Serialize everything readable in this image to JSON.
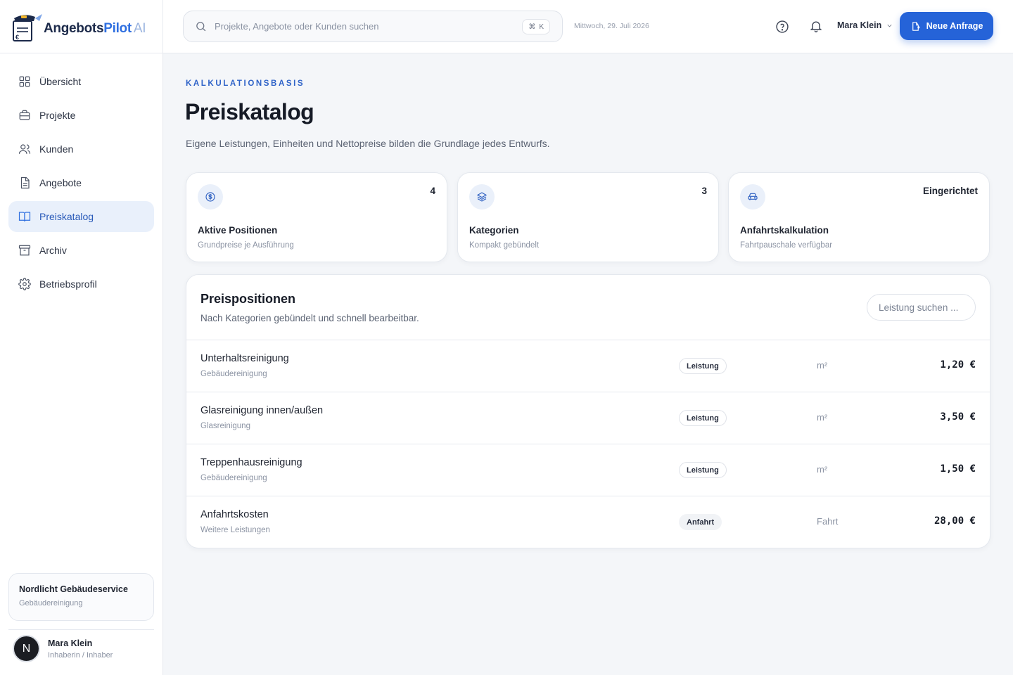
{
  "brand": {
    "part1": "Angebots",
    "part2": "Pilot",
    "part3": "AI"
  },
  "sidebar": {
    "items": [
      {
        "label": "Übersicht",
        "icon": "grid-icon"
      },
      {
        "label": "Projekte",
        "icon": "briefcase-icon"
      },
      {
        "label": "Kunden",
        "icon": "users-icon"
      },
      {
        "label": "Angebote",
        "icon": "document-icon"
      },
      {
        "label": "Preiskatalog",
        "icon": "book-icon",
        "active": true
      },
      {
        "label": "Archiv",
        "icon": "archive-icon"
      },
      {
        "label": "Betriebsprofil",
        "icon": "gear-icon"
      }
    ],
    "company": {
      "name": "Nordlicht Gebäudeservice",
      "type": "Gebäudereinigung"
    },
    "user": {
      "initial": "N",
      "name": "Mara Klein",
      "role": "Inhaberin / Inhaber"
    }
  },
  "topbar": {
    "search_placeholder": "Projekte, Angebote oder Kunden suchen",
    "shortcut_symbol": "⌘",
    "shortcut_key": "K",
    "date": "Mittwoch, 29. Juli 2026",
    "user_name": "Mara Klein",
    "primary_button": "Neue Anfrage"
  },
  "page": {
    "eyebrow": "KALKULATIONSBASIS",
    "title": "Preiskatalog",
    "subtitle": "Eigene Leistungen, Einheiten und Nettopreise bilden die Grundlage jedes Entwurfs."
  },
  "stats": [
    {
      "value": "4",
      "label": "Aktive Positionen",
      "sub": "Grundpreise je Ausführung",
      "icon": "dollar-icon"
    },
    {
      "value": "3",
      "label": "Kategorien",
      "sub": "Kompakt gebündelt",
      "icon": "layers-icon"
    },
    {
      "value": "Eingerichtet",
      "label": "Anfahrtskalkulation",
      "sub": "Fahrtpauschale verfügbar",
      "icon": "car-icon"
    }
  ],
  "table": {
    "title": "Preispositionen",
    "subtitle": "Nach Kategorien gebündelt und schnell bearbeitbar.",
    "search_placeholder": "Leistung suchen ...",
    "rows": [
      {
        "name": "Unterhaltsreinigung",
        "category": "Gebäudereinigung",
        "type": "Leistung",
        "unit": "m²",
        "price": "1,20 €"
      },
      {
        "name": "Glasreinigung innen/außen",
        "category": "Glasreinigung",
        "type": "Leistung",
        "unit": "m²",
        "price": "3,50 €"
      },
      {
        "name": "Treppenhausreinigung",
        "category": "Gebäudereinigung",
        "type": "Leistung",
        "unit": "m²",
        "price": "1,50 €"
      },
      {
        "name": "Anfahrtskosten",
        "category": "Weitere Leistungen",
        "type": "Anfahrt",
        "unit": "Fahrt",
        "price": "28,00 €"
      }
    ]
  },
  "colors": {
    "accent": "#2563d8",
    "active_bg": "#e9f0fb",
    "background": "#f4f6f9"
  }
}
